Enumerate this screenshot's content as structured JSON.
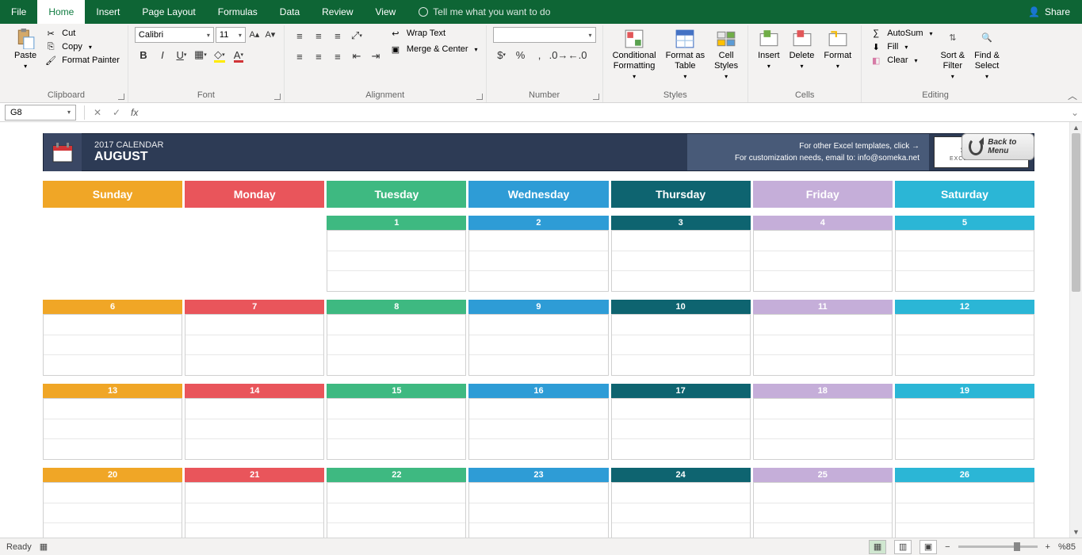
{
  "tabs": {
    "file": "File",
    "home": "Home",
    "insert": "Insert",
    "pagelayout": "Page Layout",
    "formulas": "Formulas",
    "data": "Data",
    "review": "Review",
    "view": "View",
    "tell": "Tell me what you want to do",
    "share": "Share"
  },
  "ribbon": {
    "clipboard": {
      "paste": "Paste",
      "cut": "Cut",
      "copy": "Copy",
      "fmtpainter": "Format Painter",
      "label": "Clipboard"
    },
    "font": {
      "name": "Calibri",
      "size": "11",
      "label": "Font"
    },
    "alignment": {
      "wrap": "Wrap Text",
      "merge": "Merge & Center",
      "label": "Alignment"
    },
    "number": {
      "label": "Number"
    },
    "styles": {
      "cond": "Conditional\nFormatting",
      "fat": "Format as\nTable",
      "cell": "Cell\nStyles",
      "label": "Styles"
    },
    "cells": {
      "insert": "Insert",
      "delete": "Delete",
      "format": "Format",
      "label": "Cells"
    },
    "editing": {
      "autosum": "AutoSum",
      "fill": "Fill",
      "clear": "Clear",
      "sort": "Sort &\nFilter",
      "find": "Find &\nSelect",
      "label": "Editing"
    }
  },
  "namebox": "G8",
  "calendar": {
    "year": "2017 CALENDAR",
    "month": "AUGUST",
    "info1": "For other Excel templates, click →",
    "info2": "For customization needs, email to: info@someka.net",
    "logo1": "someka",
    "logo2": "EXCEL SOLUTIONS",
    "back": "Back to Menu",
    "days": [
      "Sunday",
      "Monday",
      "Tuesday",
      "Wednesday",
      "Thursday",
      "Friday",
      "Saturday"
    ],
    "weeks": [
      [
        "",
        "",
        "1",
        "2",
        "3",
        "4",
        "5"
      ],
      [
        "6",
        "7",
        "8",
        "9",
        "10",
        "11",
        "12"
      ],
      [
        "13",
        "14",
        "15",
        "16",
        "17",
        "18",
        "19"
      ],
      [
        "20",
        "21",
        "22",
        "23",
        "24",
        "25",
        "26"
      ]
    ]
  },
  "status": {
    "ready": "Ready",
    "zoom": "%85"
  }
}
